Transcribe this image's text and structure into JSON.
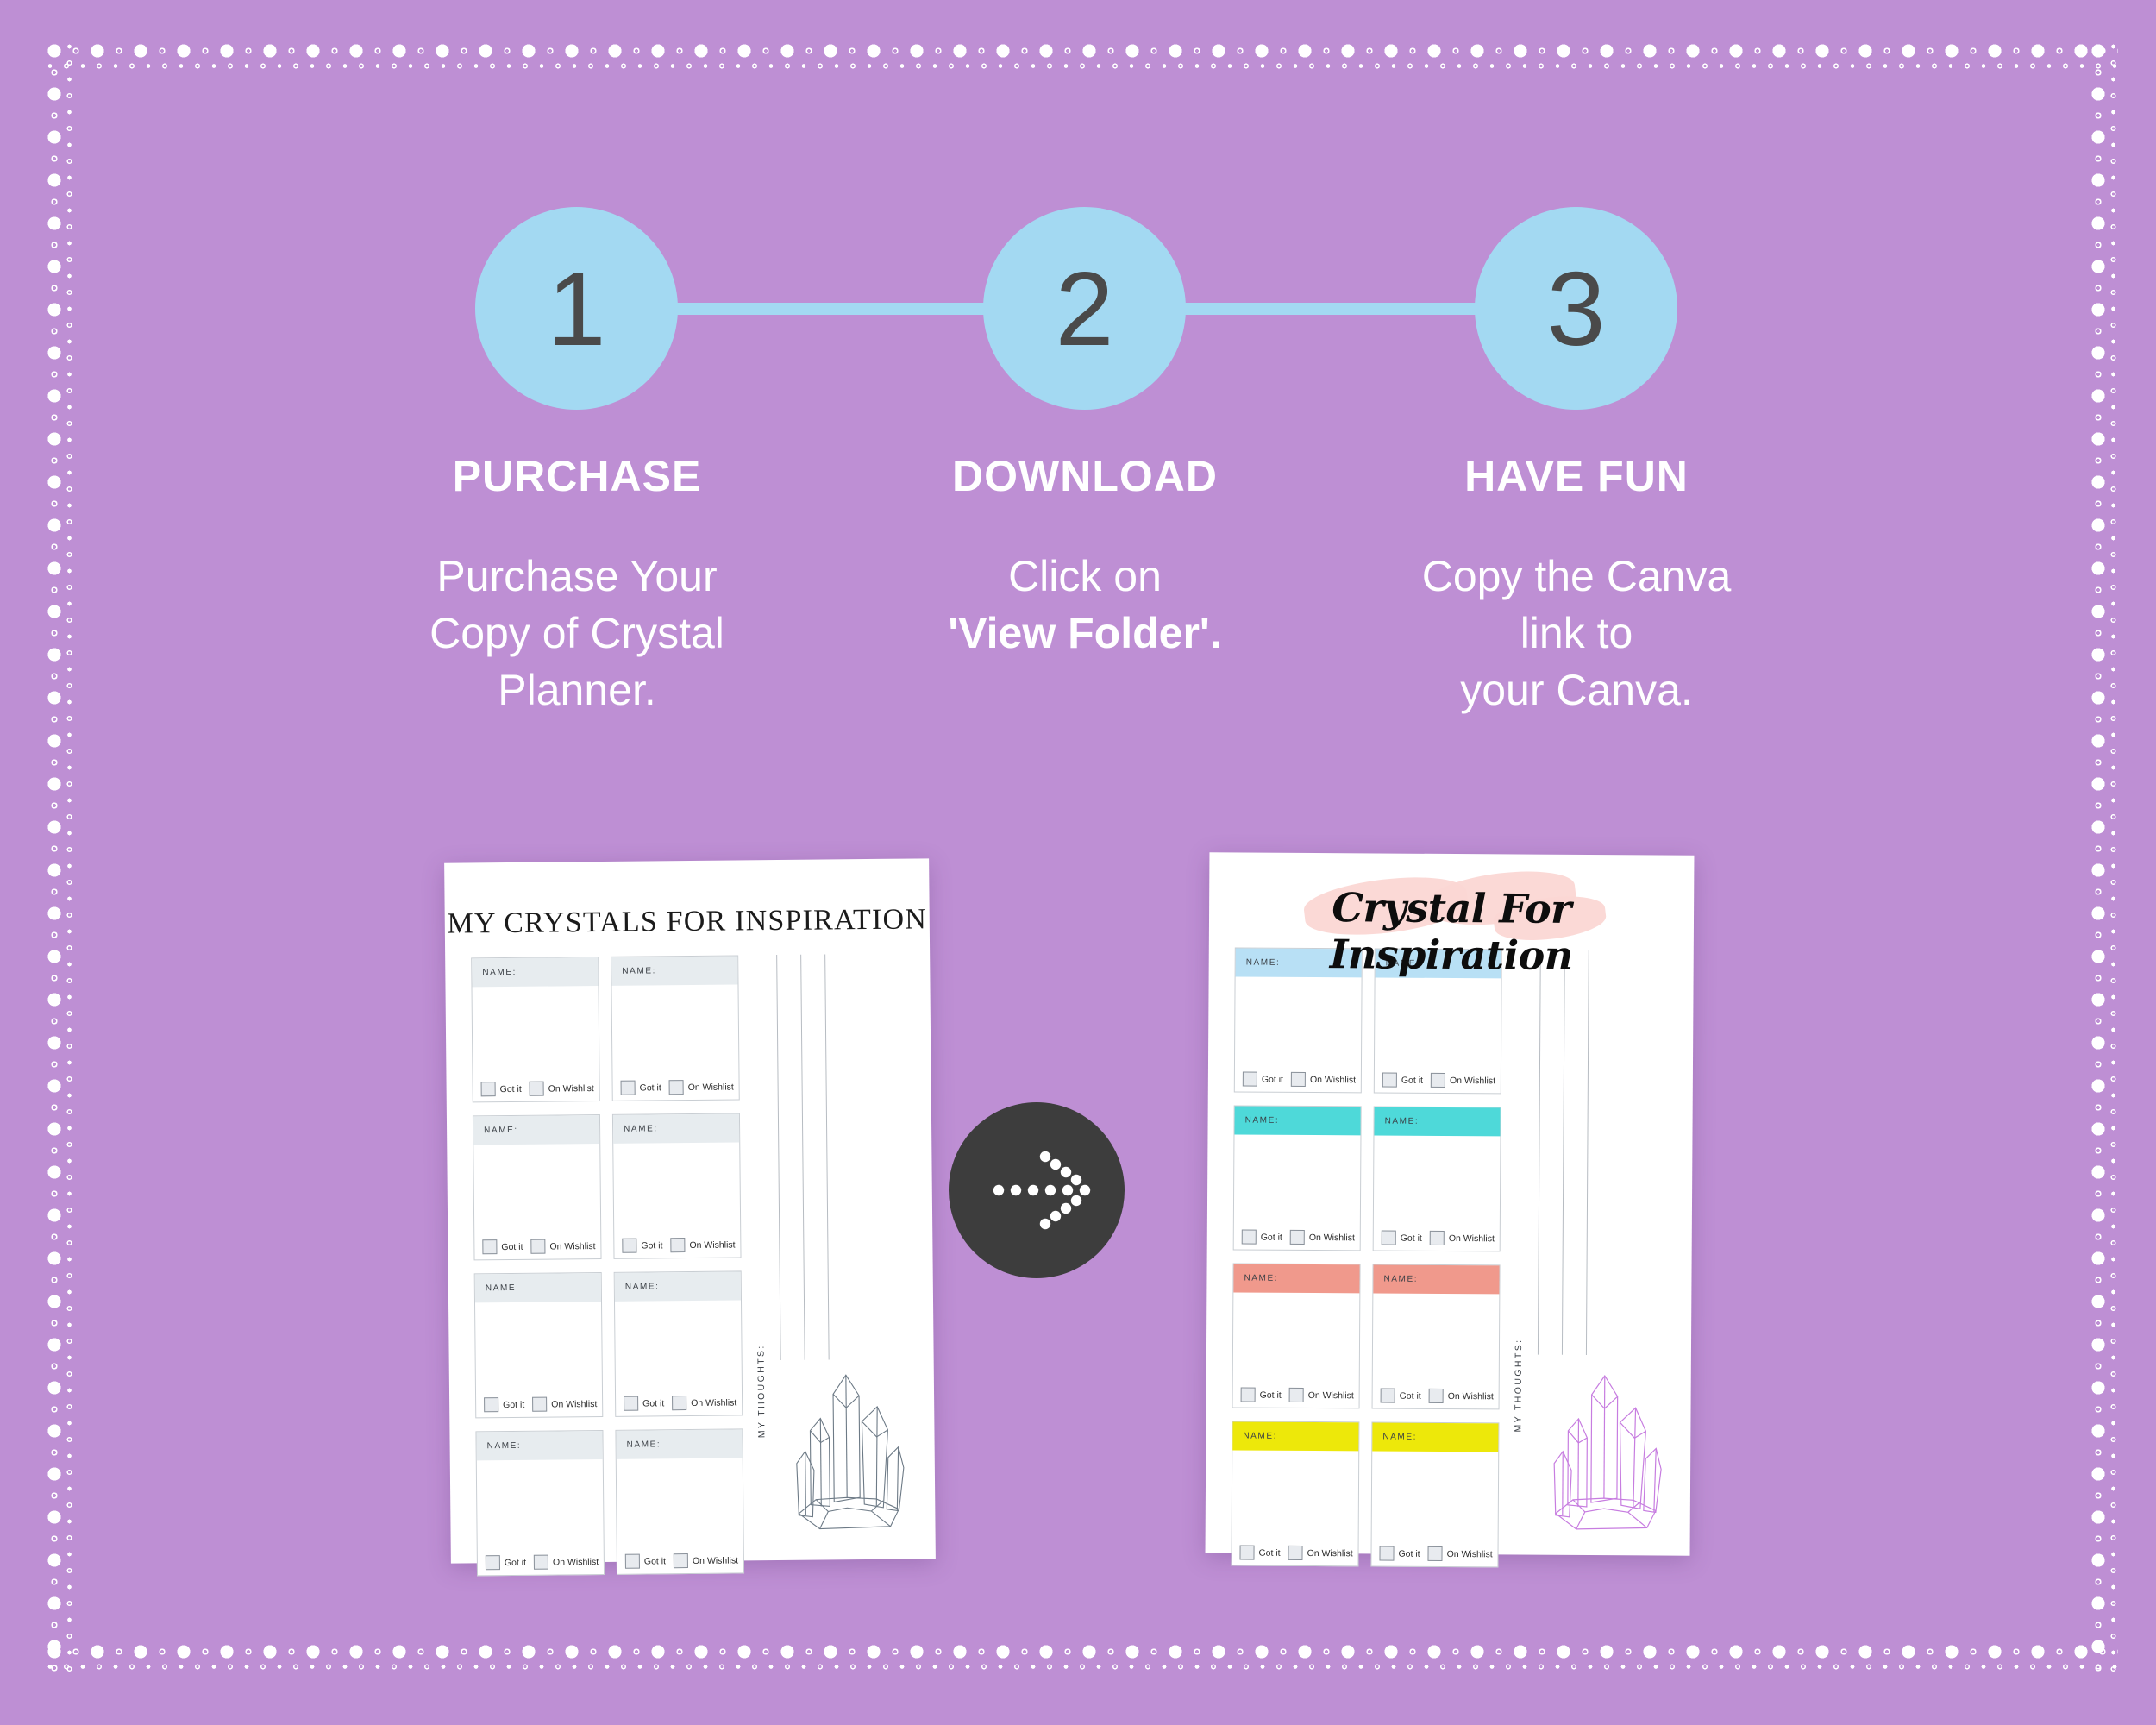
{
  "theme": {
    "background": "#be8fd4",
    "accent_blue": "#a3d9f2",
    "white": "#ffffff",
    "badge_dark": "#3d3d3d",
    "brush_pink": "#fbd7d4"
  },
  "steps": [
    {
      "number": "1",
      "label": "PURCHASE",
      "desc_lines": [
        "Purchase Your",
        "Copy of Crystal",
        "Planner."
      ]
    },
    {
      "number": "2",
      "label": "DOWNLOAD",
      "desc_lines": [
        "Click  on",
        "'View Folder'."
      ]
    },
    {
      "number": "3",
      "label": "HAVE FUN",
      "desc_lines": [
        "Copy the Canva",
        "link to",
        "your Canva."
      ]
    }
  ],
  "transition_icon": "dotted-arrow-right-icon",
  "worksheet_before": {
    "title": "MY CRYSTALS FOR INSPIRATION",
    "thoughts_label": "MY THOUGHTS:",
    "card_name_label": "NAME:",
    "checkbox_got_it": "Got it",
    "checkbox_on_wishlist": "On Wishlist",
    "crystal_color": "#6d7a86",
    "rows": [
      {
        "header_color": "#e7ecef"
      },
      {
        "header_color": "#e7ecef"
      },
      {
        "header_color": "#e7ecef"
      },
      {
        "header_color": "#e7ecef"
      }
    ]
  },
  "worksheet_after": {
    "title": "Crystal For Inspiration",
    "thoughts_label": "MY THOUGHTS:",
    "card_name_label": "NAME:",
    "checkbox_got_it": "Got it",
    "checkbox_on_wishlist": "On Wishlist",
    "crystal_color": "#c77de0",
    "rows": [
      {
        "header_color": "#b8e0f5"
      },
      {
        "header_color": "#4ed9d9"
      },
      {
        "header_color": "#f0998c"
      },
      {
        "header_color": "#ede80a"
      }
    ]
  }
}
